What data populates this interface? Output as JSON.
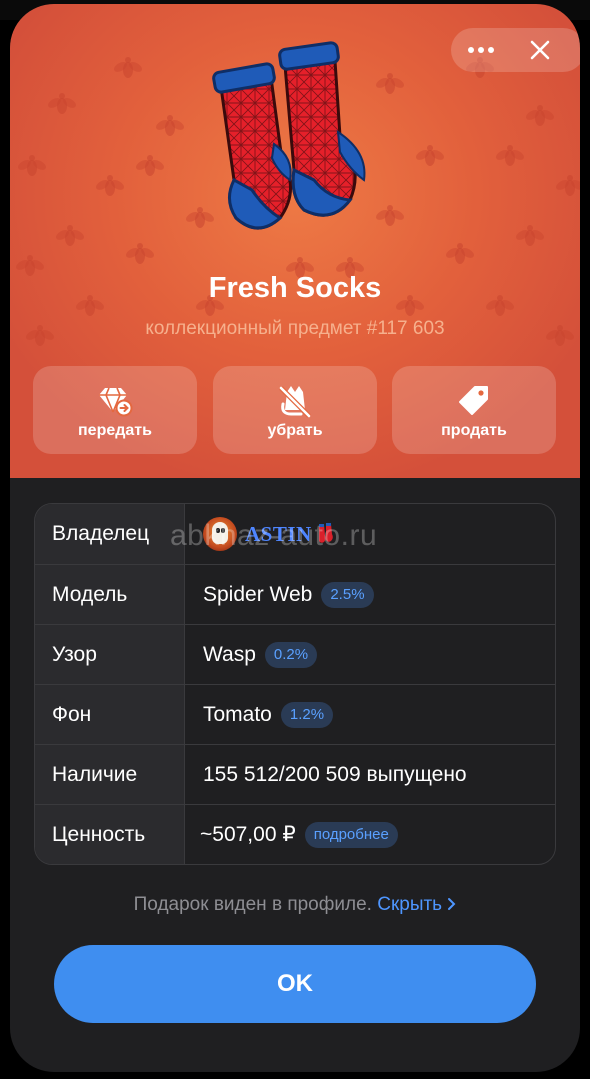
{
  "header": {
    "more_icon": "more-horizontal-icon",
    "close_icon": "close-icon"
  },
  "gift": {
    "image_icon": "socks-icon",
    "title": "Fresh Socks",
    "subtitle": "коллекционный предмет #117 603",
    "background_color": "#e2603c"
  },
  "actions": [
    {
      "label": "передать",
      "icon": "gift-transfer-icon"
    },
    {
      "label": "убрать",
      "icon": "hide-gift-icon"
    },
    {
      "label": "продать",
      "icon": "price-tag-icon"
    }
  ],
  "details": {
    "owner": {
      "label": "Владелец",
      "name": "ASTIN",
      "avatar_icon": "avatar"
    },
    "model": {
      "label": "Модель",
      "value": "Spider Web",
      "rarity": "2.5%"
    },
    "pattern": {
      "label": "Узор",
      "value": "Wasp",
      "rarity": "0.2%"
    },
    "backdrop": {
      "label": "Фон",
      "value": "Tomato",
      "rarity": "1.2%"
    },
    "availability": {
      "label": "Наличие",
      "value": "155 512/200 509 выпущено"
    },
    "value": {
      "label": "Ценность",
      "value": "~507,00 ₽",
      "link": "подробнее"
    }
  },
  "watermark": "abkhaz-auto.ru",
  "footer": {
    "visibility_text": "Подарок виден в профиле.",
    "hide_link": "Скрыть",
    "ok_label": "OK"
  },
  "colors": {
    "accent": "#3f8ef0",
    "link": "#4e96ff",
    "badge_text": "#5aa0ff",
    "sheet_bg": "#1f1f21"
  }
}
